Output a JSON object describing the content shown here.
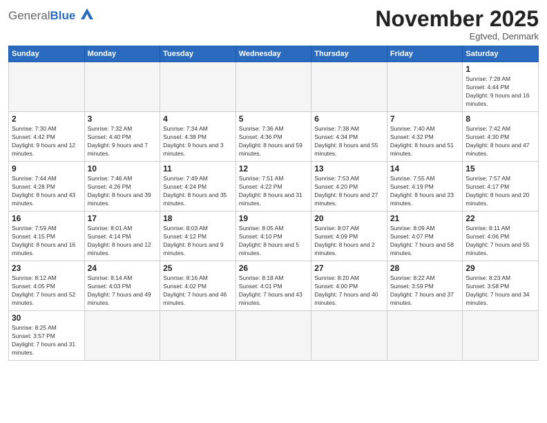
{
  "header": {
    "logo_general": "General",
    "logo_blue": "Blue",
    "month_title": "November 2025",
    "location": "Egtved, Denmark"
  },
  "weekdays": [
    "Sunday",
    "Monday",
    "Tuesday",
    "Wednesday",
    "Thursday",
    "Friday",
    "Saturday"
  ],
  "weeks": [
    [
      {
        "day": "",
        "sunrise": "",
        "sunset": "",
        "daylight": ""
      },
      {
        "day": "",
        "sunrise": "",
        "sunset": "",
        "daylight": ""
      },
      {
        "day": "",
        "sunrise": "",
        "sunset": "",
        "daylight": ""
      },
      {
        "day": "",
        "sunrise": "",
        "sunset": "",
        "daylight": ""
      },
      {
        "day": "",
        "sunrise": "",
        "sunset": "",
        "daylight": ""
      },
      {
        "day": "",
        "sunrise": "",
        "sunset": "",
        "daylight": ""
      },
      {
        "day": "1",
        "sunrise": "Sunrise: 7:28 AM",
        "sunset": "Sunset: 4:44 PM",
        "daylight": "Daylight: 9 hours and 16 minutes."
      }
    ],
    [
      {
        "day": "2",
        "sunrise": "Sunrise: 7:30 AM",
        "sunset": "Sunset: 4:42 PM",
        "daylight": "Daylight: 9 hours and 12 minutes."
      },
      {
        "day": "3",
        "sunrise": "Sunrise: 7:32 AM",
        "sunset": "Sunset: 4:40 PM",
        "daylight": "Daylight: 9 hours and 7 minutes."
      },
      {
        "day": "4",
        "sunrise": "Sunrise: 7:34 AM",
        "sunset": "Sunset: 4:38 PM",
        "daylight": "Daylight: 9 hours and 3 minutes."
      },
      {
        "day": "5",
        "sunrise": "Sunrise: 7:36 AM",
        "sunset": "Sunset: 4:36 PM",
        "daylight": "Daylight: 8 hours and 59 minutes."
      },
      {
        "day": "6",
        "sunrise": "Sunrise: 7:38 AM",
        "sunset": "Sunset: 4:34 PM",
        "daylight": "Daylight: 8 hours and 55 minutes."
      },
      {
        "day": "7",
        "sunrise": "Sunrise: 7:40 AM",
        "sunset": "Sunset: 4:32 PM",
        "daylight": "Daylight: 8 hours and 51 minutes."
      },
      {
        "day": "8",
        "sunrise": "Sunrise: 7:42 AM",
        "sunset": "Sunset: 4:30 PM",
        "daylight": "Daylight: 8 hours and 47 minutes."
      }
    ],
    [
      {
        "day": "9",
        "sunrise": "Sunrise: 7:44 AM",
        "sunset": "Sunset: 4:28 PM",
        "daylight": "Daylight: 8 hours and 43 minutes."
      },
      {
        "day": "10",
        "sunrise": "Sunrise: 7:46 AM",
        "sunset": "Sunset: 4:26 PM",
        "daylight": "Daylight: 8 hours and 39 minutes."
      },
      {
        "day": "11",
        "sunrise": "Sunrise: 7:49 AM",
        "sunset": "Sunset: 4:24 PM",
        "daylight": "Daylight: 8 hours and 35 minutes."
      },
      {
        "day": "12",
        "sunrise": "Sunrise: 7:51 AM",
        "sunset": "Sunset: 4:22 PM",
        "daylight": "Daylight: 8 hours and 31 minutes."
      },
      {
        "day": "13",
        "sunrise": "Sunrise: 7:53 AM",
        "sunset": "Sunset: 4:20 PM",
        "daylight": "Daylight: 8 hours and 27 minutes."
      },
      {
        "day": "14",
        "sunrise": "Sunrise: 7:55 AM",
        "sunset": "Sunset: 4:19 PM",
        "daylight": "Daylight: 8 hours and 23 minutes."
      },
      {
        "day": "15",
        "sunrise": "Sunrise: 7:57 AM",
        "sunset": "Sunset: 4:17 PM",
        "daylight": "Daylight: 8 hours and 20 minutes."
      }
    ],
    [
      {
        "day": "16",
        "sunrise": "Sunrise: 7:59 AM",
        "sunset": "Sunset: 4:15 PM",
        "daylight": "Daylight: 8 hours and 16 minutes."
      },
      {
        "day": "17",
        "sunrise": "Sunrise: 8:01 AM",
        "sunset": "Sunset: 4:14 PM",
        "daylight": "Daylight: 8 hours and 12 minutes."
      },
      {
        "day": "18",
        "sunrise": "Sunrise: 8:03 AM",
        "sunset": "Sunset: 4:12 PM",
        "daylight": "Daylight: 8 hours and 9 minutes."
      },
      {
        "day": "19",
        "sunrise": "Sunrise: 8:05 AM",
        "sunset": "Sunset: 4:10 PM",
        "daylight": "Daylight: 8 hours and 5 minutes."
      },
      {
        "day": "20",
        "sunrise": "Sunrise: 8:07 AM",
        "sunset": "Sunset: 4:09 PM",
        "daylight": "Daylight: 8 hours and 2 minutes."
      },
      {
        "day": "21",
        "sunrise": "Sunrise: 8:09 AM",
        "sunset": "Sunset: 4:07 PM",
        "daylight": "Daylight: 7 hours and 58 minutes."
      },
      {
        "day": "22",
        "sunrise": "Sunrise: 8:11 AM",
        "sunset": "Sunset: 4:06 PM",
        "daylight": "Daylight: 7 hours and 55 minutes."
      }
    ],
    [
      {
        "day": "23",
        "sunrise": "Sunrise: 8:12 AM",
        "sunset": "Sunset: 4:05 PM",
        "daylight": "Daylight: 7 hours and 52 minutes."
      },
      {
        "day": "24",
        "sunrise": "Sunrise: 8:14 AM",
        "sunset": "Sunset: 4:03 PM",
        "daylight": "Daylight: 7 hours and 49 minutes."
      },
      {
        "day": "25",
        "sunrise": "Sunrise: 8:16 AM",
        "sunset": "Sunset: 4:02 PM",
        "daylight": "Daylight: 7 hours and 46 minutes."
      },
      {
        "day": "26",
        "sunrise": "Sunrise: 8:18 AM",
        "sunset": "Sunset: 4:01 PM",
        "daylight": "Daylight: 7 hours and 43 minutes."
      },
      {
        "day": "27",
        "sunrise": "Sunrise: 8:20 AM",
        "sunset": "Sunset: 4:00 PM",
        "daylight": "Daylight: 7 hours and 40 minutes."
      },
      {
        "day": "28",
        "sunrise": "Sunrise: 8:22 AM",
        "sunset": "Sunset: 3:59 PM",
        "daylight": "Daylight: 7 hours and 37 minutes."
      },
      {
        "day": "29",
        "sunrise": "Sunrise: 8:23 AM",
        "sunset": "Sunset: 3:58 PM",
        "daylight": "Daylight: 7 hours and 34 minutes."
      }
    ],
    [
      {
        "day": "30",
        "sunrise": "Sunrise: 8:25 AM",
        "sunset": "Sunset: 3:57 PM",
        "daylight": "Daylight: 7 hours and 31 minutes."
      },
      {
        "day": "",
        "sunrise": "",
        "sunset": "",
        "daylight": ""
      },
      {
        "day": "",
        "sunrise": "",
        "sunset": "",
        "daylight": ""
      },
      {
        "day": "",
        "sunrise": "",
        "sunset": "",
        "daylight": ""
      },
      {
        "day": "",
        "sunrise": "",
        "sunset": "",
        "daylight": ""
      },
      {
        "day": "",
        "sunrise": "",
        "sunset": "",
        "daylight": ""
      },
      {
        "day": "",
        "sunrise": "",
        "sunset": "",
        "daylight": ""
      }
    ]
  ]
}
